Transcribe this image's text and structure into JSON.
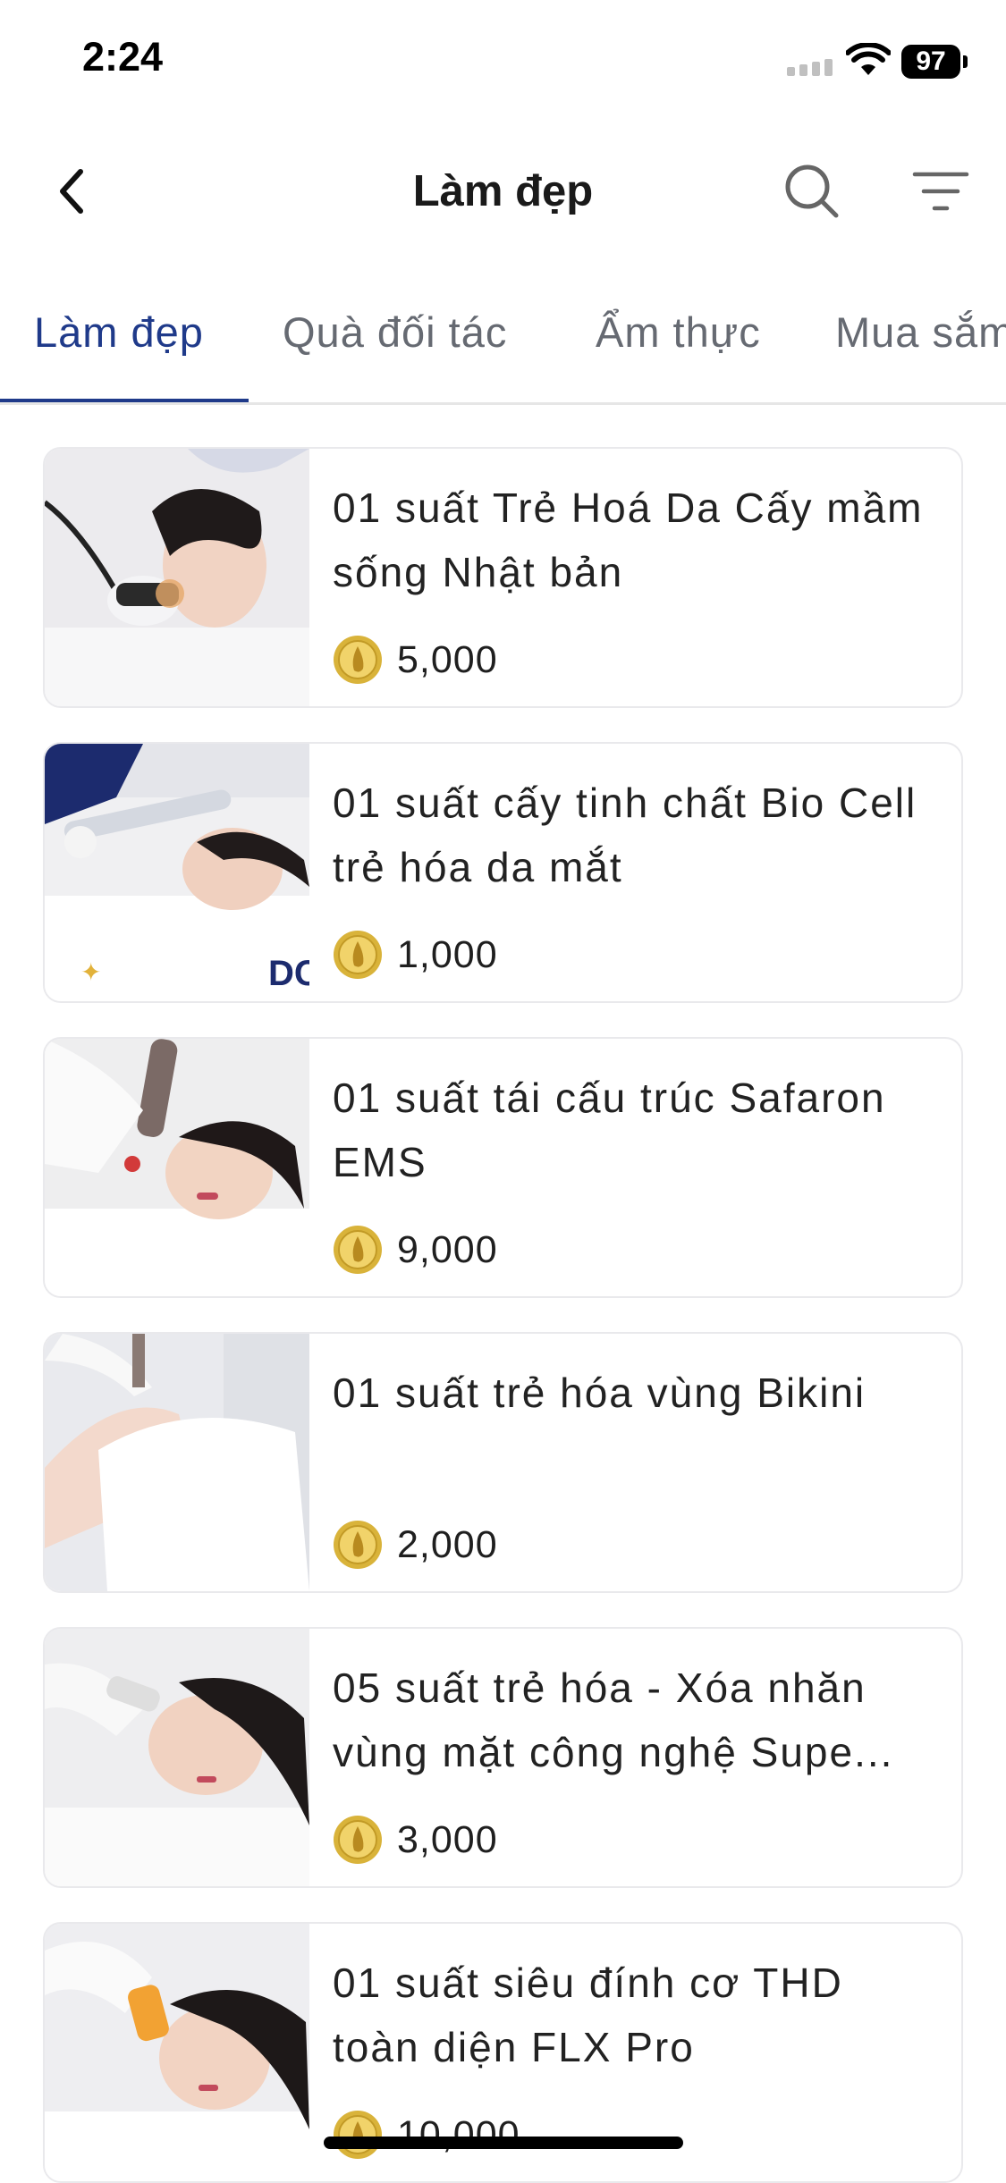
{
  "status_bar": {
    "time": "2:24",
    "battery": "97"
  },
  "header": {
    "title": "Làm đẹp"
  },
  "tabs": [
    {
      "label": "Làm đẹp",
      "active": true
    },
    {
      "label": "Quà đối tác",
      "active": false
    },
    {
      "label": "Ẩm thực",
      "active": false
    },
    {
      "label": "Mua sắm",
      "active": false
    }
  ],
  "products": [
    {
      "title": "01 suất Trẻ Hoá Da Cấy mầm sống Nhật bản",
      "price": "5,000"
    },
    {
      "title": "01 suất cấy tinh chất Bio Cell trẻ hóa da mắt",
      "price": "1,000"
    },
    {
      "title": "01 suất tái cấu trúc Safaron EMS",
      "price": "9,000"
    },
    {
      "title": "01 suất trẻ hóa vùng Bikini",
      "price": "2,000"
    },
    {
      "title": "05 suất trẻ hóa - Xóa nhăn vùng mặt công nghệ Supe...",
      "price": "3,000"
    },
    {
      "title": "01 suất siêu đính cơ THD toàn diện FLX Pro",
      "price": "10,000"
    }
  ],
  "colors": {
    "accent": "#1f3a8a",
    "coin": "#d9b33a",
    "tab_inactive": "#666a72"
  },
  "icons": [
    "back-chevron-icon",
    "search-icon",
    "filter-icon",
    "coin-icon",
    "wifi-icon",
    "signal-icon"
  ]
}
